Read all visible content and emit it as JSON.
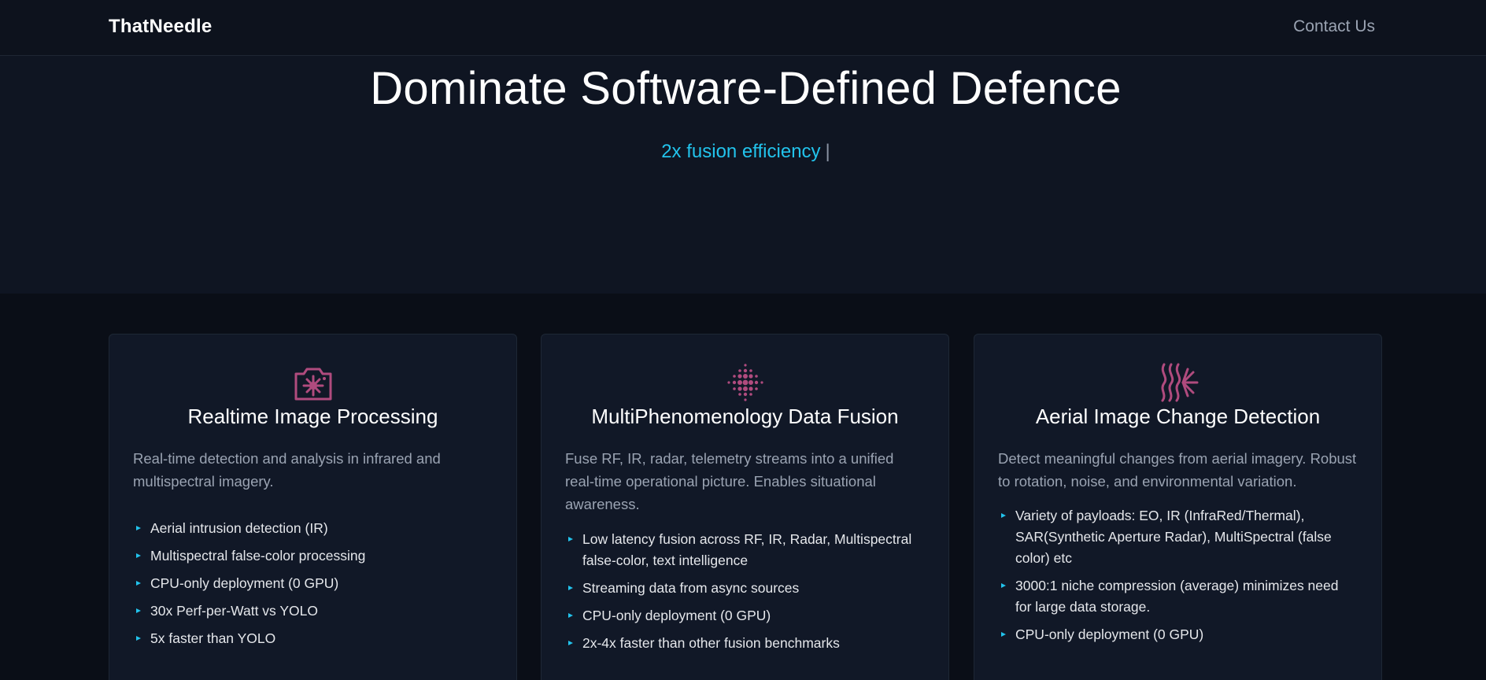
{
  "header": {
    "logo": "ThatNeedle",
    "contact_label": "Contact Us"
  },
  "hero": {
    "title": "Dominate Software-Defined Defence",
    "typed_text": "2x fusion efficiency",
    "cursor": "|"
  },
  "colors": {
    "accent": "#22c3ec",
    "icon": "#b04b7e",
    "background": "#0b0f19",
    "card": "#111827"
  },
  "cards": [
    {
      "icon": "camera-burst-icon",
      "title": "Realtime Image Processing",
      "description": "Real-time detection and analysis in infrared and multispectral imagery.",
      "bullets": [
        "Aerial intrusion detection (IR)",
        "Multispectral false-color processing",
        "CPU-only deployment (0 GPU)",
        "30x Perf-per-Watt vs YOLO",
        "5x faster than YOLO"
      ]
    },
    {
      "icon": "dot-grid-icon",
      "title": "MultiPhenomenology Data Fusion",
      "description": "Fuse RF, IR, radar, telemetry streams into a unified real-time operational picture. Enables situational awareness.",
      "bullets": [
        "Low latency fusion across RF, IR, Radar, Multispectral false-color, text intelligence",
        "Streaming data from async sources",
        "CPU-only deployment (0 GPU)",
        "2x-4x faster than other fusion benchmarks"
      ]
    },
    {
      "icon": "waves-burst-icon",
      "title": "Aerial Image Change Detection",
      "description": "Detect meaningful changes from aerial imagery. Robust to rotation, noise, and environmental variation.",
      "bullets": [
        "Variety of payloads: EO, IR (InfraRed/Thermal), SAR(Synthetic Aperture Radar), MultiSpectral (false color) etc",
        "3000:1 niche compression (average) minimizes need for large data storage.",
        "CPU-only deployment (0 GPU)"
      ]
    }
  ]
}
